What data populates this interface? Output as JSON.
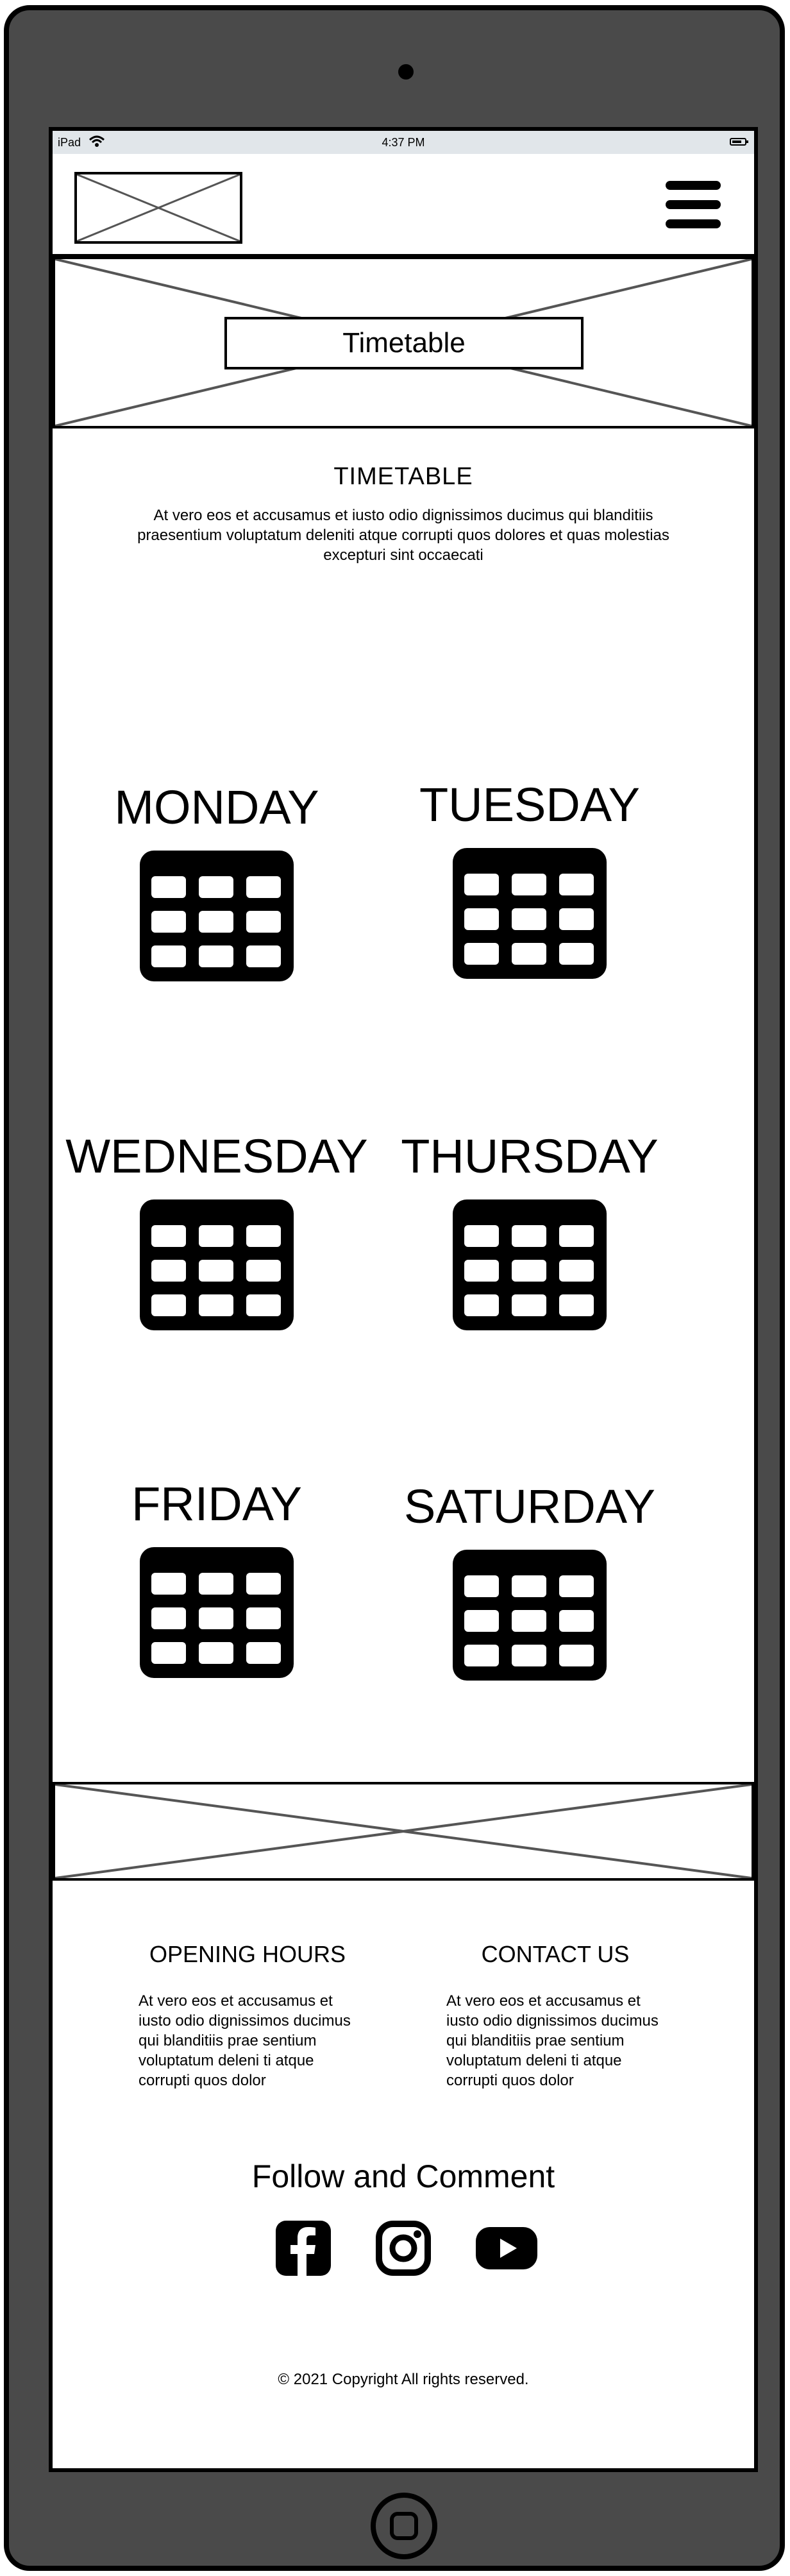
{
  "status_bar": {
    "device": "iPad",
    "time": "4:37 PM"
  },
  "hero": {
    "label": "Timetable"
  },
  "timetable": {
    "title": "TIMETABLE",
    "intro": "At vero eos et accusamus et iusto odio dignissimos ducimus qui blanditiis praesentium voluptatum deleniti atque corrupti quos dolores et quas molestias excepturi sint occaecati"
  },
  "days": [
    "MONDAY",
    "TUESDAY",
    "WEDNESDAY",
    "THURSDAY",
    "FRIDAY",
    "SATURDAY"
  ],
  "footer": {
    "opening_hours_title": "OPENING HOURS",
    "opening_hours_text": "At vero eos et accusamus et iusto odio dignissimos ducimus qui blanditiis prae sentium voluptatum deleni ti atque corrupti quos dolor",
    "contact_title": "CONTACT US",
    "contact_text": "At vero eos et accusamus et iusto odio dignissimos ducimus qui blanditiis prae sentium voluptatum deleni ti atque corrupti quos dolor",
    "follow_title": "Follow and Comment",
    "copyright": "© 2021 Copyright All rights reserved."
  },
  "icons": {
    "menu": "hamburger-menu-icon",
    "calendar": "calendar-grid-icon",
    "social": [
      "facebook-icon",
      "instagram-icon",
      "youtube-icon"
    ]
  },
  "colors": {
    "device_frame": "#4a4a4a",
    "status_bar": "#e1e6ea",
    "placeholder_line": "#555555"
  }
}
